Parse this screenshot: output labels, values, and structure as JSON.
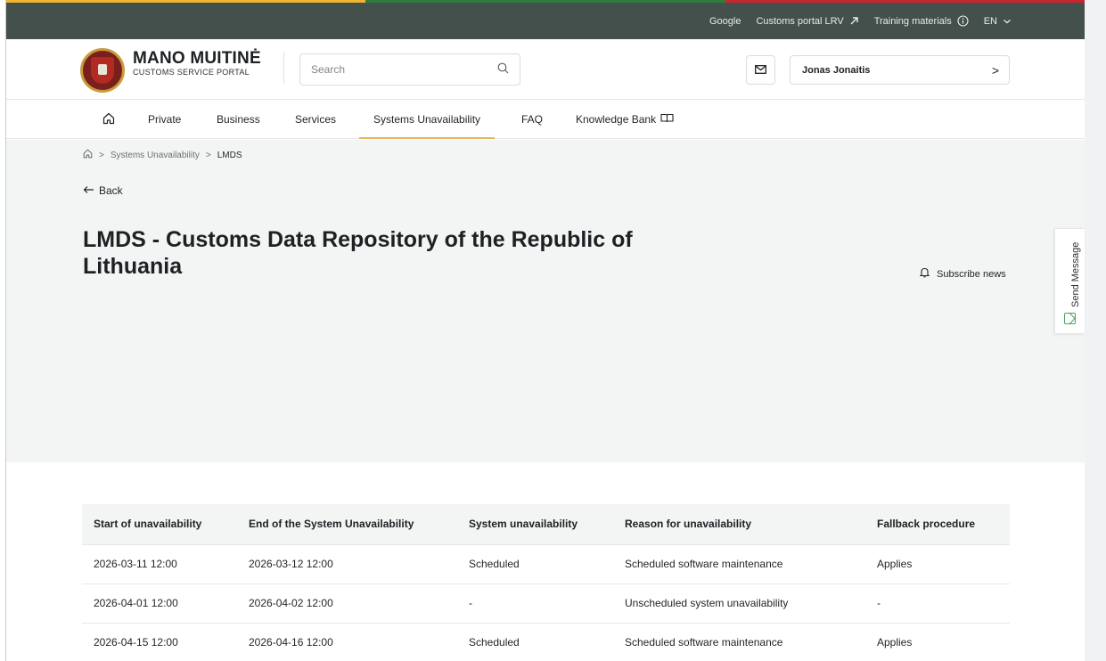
{
  "colors": {
    "flag": [
      "#f2b531",
      "#2f7d3c",
      "#c9262d"
    ],
    "topbar_bg": "#44504b",
    "nav_active_underline": "#e3b85c",
    "hero_bg": "#f3f4f4",
    "send_icon": "#4aa25c"
  },
  "topbar": {
    "links": [
      {
        "label": "Google",
        "icon": null
      },
      {
        "label": "Customs portal LRV",
        "icon": "external-arrow-icon"
      },
      {
        "label": "Training materials",
        "icon": "info-circle-icon"
      }
    ],
    "language": {
      "label": "EN",
      "icon": "chevron-down-icon"
    }
  },
  "header": {
    "logo_icon": "coat-of-arms-icon",
    "brand_title": "MANO MUITINĖ",
    "brand_subtitle": "CUSTOMS SERVICE PORTAL",
    "search": {
      "placeholder": "Search",
      "icon": "search-icon"
    },
    "mail_icon": "mail-icon",
    "user": {
      "name": "Jonas Jonaitis",
      "chevron": ">"
    }
  },
  "nav": {
    "home_icon": "home-icon",
    "items": [
      {
        "label": "Private",
        "active": false
      },
      {
        "label": "Business",
        "active": false
      },
      {
        "label": "Services",
        "active": false
      },
      {
        "label": "Systems Unavailability",
        "active": true
      },
      {
        "label": "FAQ",
        "active": false
      },
      {
        "label": "Knowledge Bank",
        "active": false,
        "icon": "book-icon"
      }
    ]
  },
  "breadcrumb": {
    "items": [
      "Systems Unavailability",
      "LMDS"
    ],
    "separator": ">"
  },
  "back_label": "Back",
  "page_title": "LMDS - Customs Data Repository of the Republic of Lithuania",
  "subscribe_label": "Subscribe news",
  "send_message_label": "Send Message",
  "table": {
    "headers": [
      "Start of unavailability",
      "End of the System Unavailability",
      "System unavailability",
      "Reason for unavailability",
      "Fallback procedure"
    ],
    "rows": [
      [
        "2026-03-11 12:00",
        "2026-03-12 12:00",
        "Scheduled",
        "Scheduled software maintenance",
        "Applies"
      ],
      [
        "2026-04-01 12:00",
        "2026-04-02 12:00",
        "-",
        "Unscheduled system unavailability",
        "-"
      ],
      [
        "2026-04-15 12:00",
        "2026-04-16 12:00",
        "Scheduled",
        "Scheduled software maintenance",
        "Applies"
      ]
    ]
  }
}
